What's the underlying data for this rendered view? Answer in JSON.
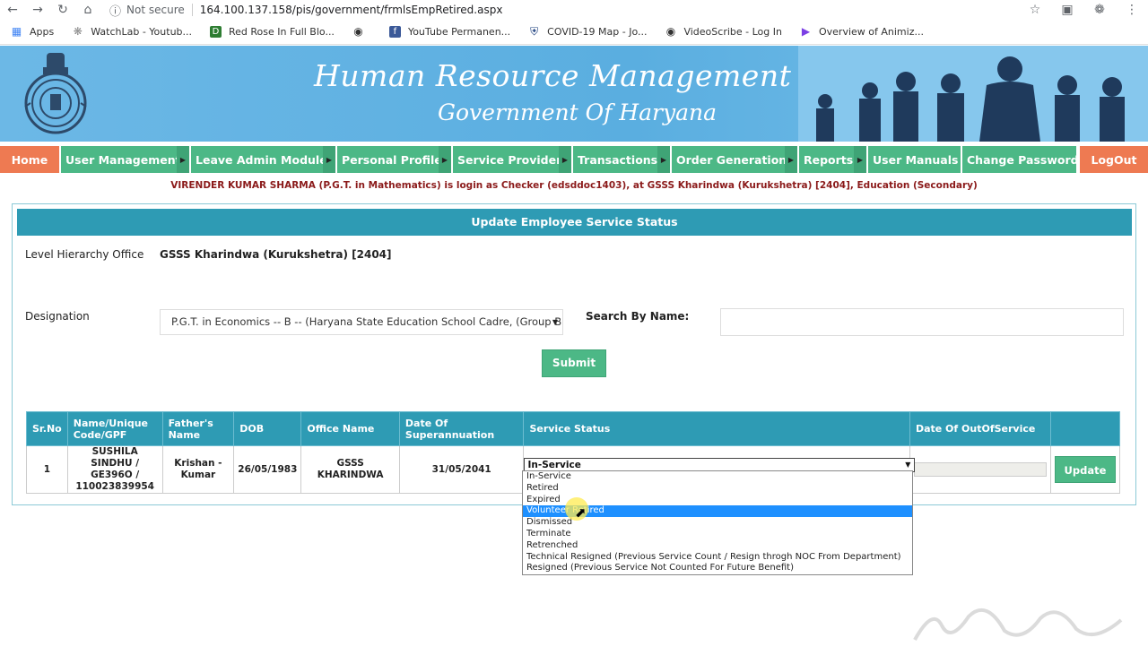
{
  "browser": {
    "security_label": "Not secure",
    "url": "164.100.137.158/pis/government/frmlsEmpRetired.aspx",
    "bookmarks": [
      {
        "label": "Apps"
      },
      {
        "label": "WatchLab - Youtub..."
      },
      {
        "label": "Red Rose In Full Blo..."
      },
      {
        "label": ""
      },
      {
        "label": "YouTube Permanen..."
      },
      {
        "label": "COVID-19 Map - Jo..."
      },
      {
        "label": "VideoScribe - Log In"
      },
      {
        "label": "Overview of Animiz..."
      }
    ]
  },
  "banner": {
    "title": "Human Resource Management System",
    "subtitle": "Government Of Haryana"
  },
  "menu": [
    {
      "label": "Home"
    },
    {
      "label": "User Management"
    },
    {
      "label": "Leave Admin Module"
    },
    {
      "label": "Personal Profile"
    },
    {
      "label": "Service Provider"
    },
    {
      "label": "Transactions"
    },
    {
      "label": "Order Generation"
    },
    {
      "label": "Reports"
    },
    {
      "label": "User Manuals"
    },
    {
      "label": "Change Password"
    },
    {
      "label": "LogOut"
    }
  ],
  "login_info": "VIRENDER KUMAR SHARMA (P.G.T. in Mathematics) is login as Checker (edsddoc1403), at GSSS Kharindwa (Kurukshetra) [2404], Education (Secondary)",
  "panel": {
    "title": "Update Employee Service Status",
    "level_label": "Level Hierarchy Office",
    "level_value": "GSSS Kharindwa (Kurukshetra) [2404]",
    "designation_label": "Designation",
    "designation_value": "P.G.T. in Economics -- B -- (Haryana State Education School Cadre, (Group B) Se",
    "search_label": "Search By Name:",
    "search_value": "",
    "submit_label": "Submit"
  },
  "table": {
    "headers": [
      "Sr.No",
      "Name/Unique Code/GPF",
      "Father's Name",
      "DOB",
      "Office Name",
      "Date Of Superannuation",
      "Service Status",
      "Date Of OutOfService",
      ""
    ],
    "row": {
      "sr": "1",
      "name": "SUSHILA SINDHU / GE396O / 110023839954",
      "father": "Krishan - Kumar",
      "dob": "26/05/1983",
      "office": "GSSS KHARINDWA",
      "superannuation": "31/05/2041",
      "status": "In-Service",
      "update_label": "Update"
    }
  },
  "status_options": [
    "In-Service",
    "Retired",
    "Expired",
    "Volunteer Retired",
    "Dismissed",
    "Terminate",
    "Retrenched",
    "Technical Resigned (Previous Service Count / Resign throgh NOC From Department)",
    "Resigned (Previous Service Not Counted For Future Benefit)"
  ],
  "highlighted_option_index": 3,
  "colors": {
    "menu_green": "#4cb886",
    "menu_orange": "#ee7a52",
    "header_teal": "#2e9bb4",
    "login_text": "#8b1a1a"
  }
}
